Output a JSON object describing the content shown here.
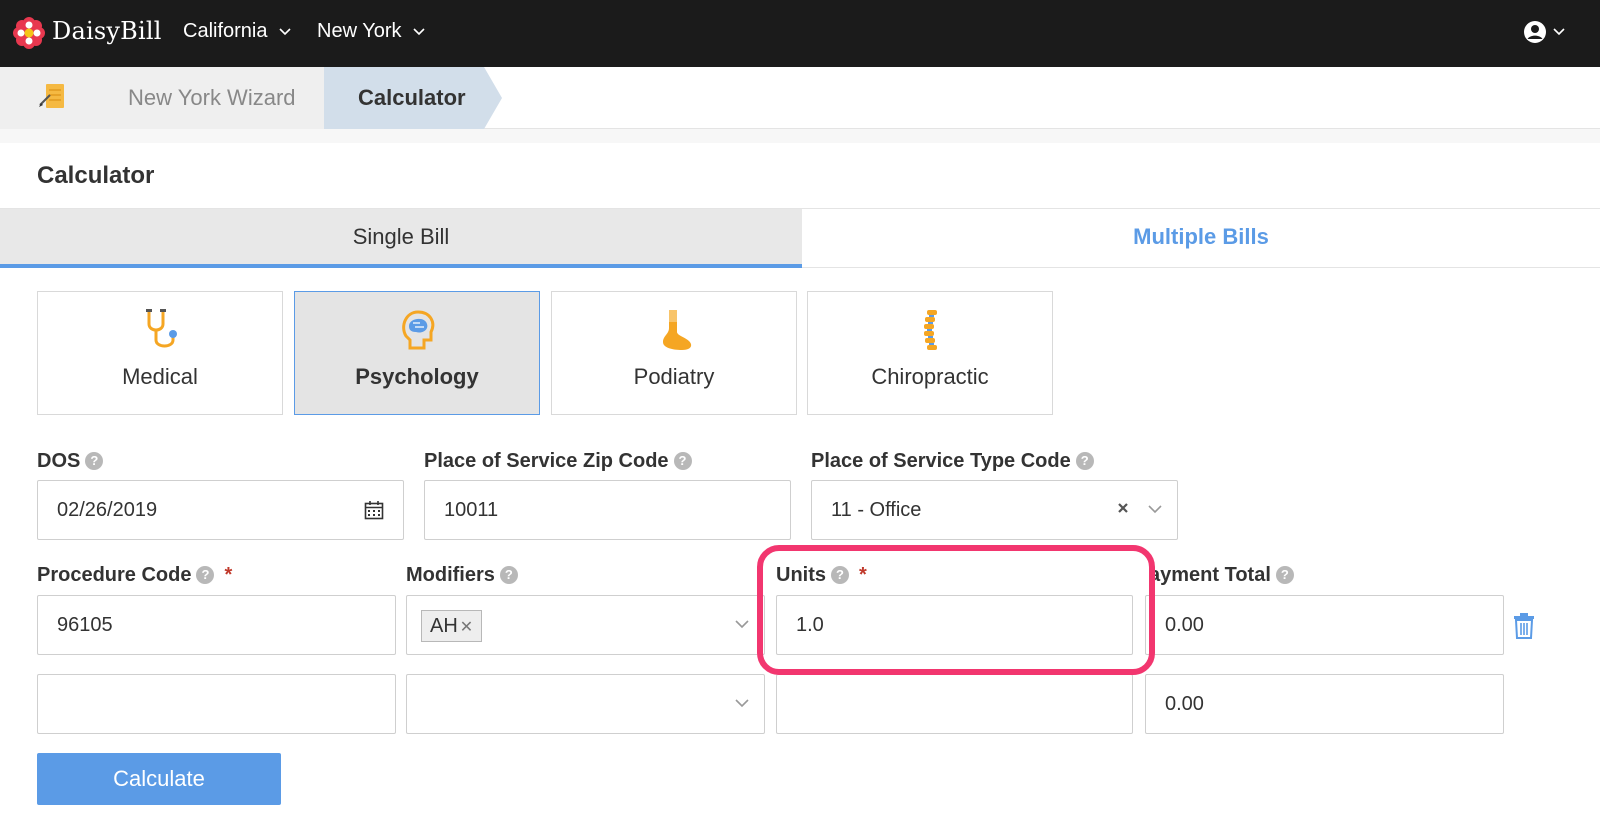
{
  "brand": {
    "name": "DaisyBill"
  },
  "nav": {
    "items": [
      {
        "label": "California"
      },
      {
        "label": "New York"
      }
    ]
  },
  "breadcrumb": {
    "items": [
      {
        "label": "New York Wizard"
      },
      {
        "label": "Calculator"
      }
    ]
  },
  "page": {
    "title": "Calculator"
  },
  "tabs": [
    {
      "label": "Single Bill",
      "active": true
    },
    {
      "label": "Multiple Bills",
      "active": false
    }
  ],
  "specialties": [
    {
      "label": "Medical",
      "icon": "stethoscope-icon",
      "selected": false
    },
    {
      "label": "Psychology",
      "icon": "brain-icon",
      "selected": true
    },
    {
      "label": "Podiatry",
      "icon": "foot-icon",
      "selected": false
    },
    {
      "label": "Chiropractic",
      "icon": "spine-icon",
      "selected": false
    }
  ],
  "form": {
    "dos": {
      "label": "DOS",
      "value": "02/26/2019"
    },
    "zip": {
      "label": "Place of Service Zip Code",
      "value": "10011"
    },
    "pos_type": {
      "label": "Place of Service Type Code",
      "value": "11 - Office"
    },
    "procedure": {
      "label": "Procedure Code",
      "required_mark": "*"
    },
    "modifiers": {
      "label": "Modifiers"
    },
    "units": {
      "label": "Units",
      "required_mark": "*"
    },
    "payment_total": {
      "label": "ayment Total"
    },
    "rows": [
      {
        "procedure": "96105",
        "modifier_tag": "AH",
        "units": "1.0",
        "payment_total": "0.00"
      },
      {
        "procedure": "",
        "modifier_tag": "",
        "units": "",
        "payment_total": "0.00"
      }
    ]
  },
  "actions": {
    "calculate": "Calculate"
  },
  "colors": {
    "accent": "#5b9be6",
    "highlight": "#f2366f",
    "topbar": "#1b1b1b",
    "icon_orange": "#f5a623"
  }
}
